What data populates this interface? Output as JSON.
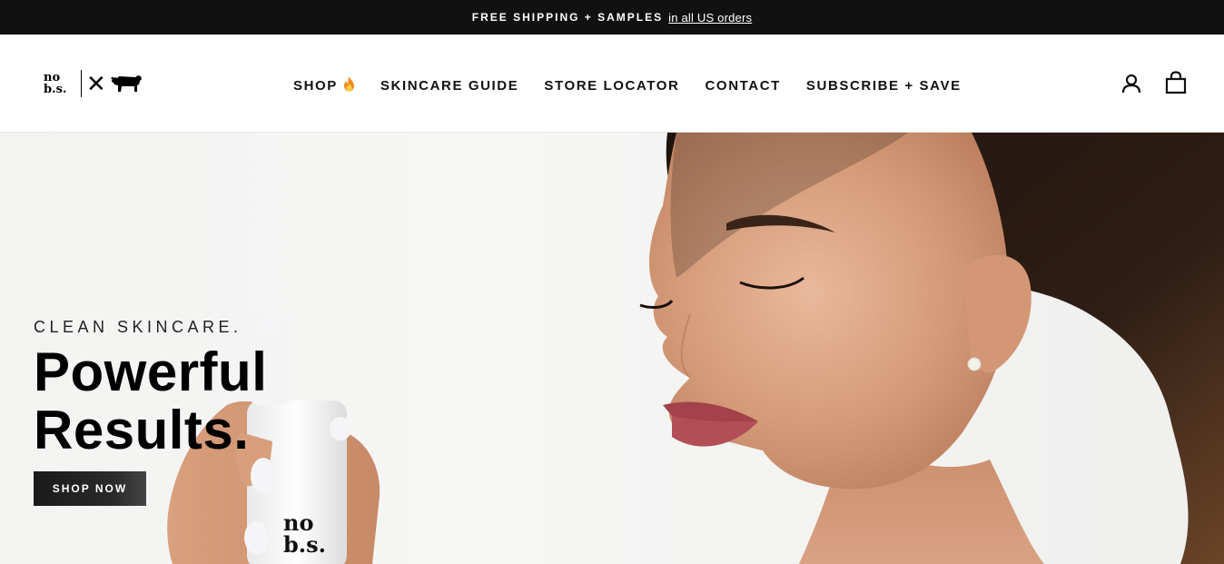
{
  "announcement": {
    "bold_text": "FREE SHIPPING + SAMPLES",
    "link_text": "in all US orders"
  },
  "header": {
    "logo_text": "no b.s.",
    "logo_x": "✕",
    "nav": [
      {
        "label": "SHOP",
        "icon": "fire-icon"
      },
      {
        "label": "SKINCARE GUIDE"
      },
      {
        "label": "STORE LOCATOR"
      },
      {
        "label": "CONTACT"
      },
      {
        "label": "SUBSCRIBE + SAVE"
      }
    ],
    "icons": [
      "account-icon",
      "cart-icon"
    ]
  },
  "hero": {
    "subtitle": "CLEAN SKINCARE.",
    "title": "Powerful Results.",
    "button_label": "SHOP NOW",
    "bottle_label": "no b.s."
  },
  "colors": {
    "announcement_bg": "#111111",
    "button_bg": "#1a1a1a",
    "text": "#111111"
  }
}
